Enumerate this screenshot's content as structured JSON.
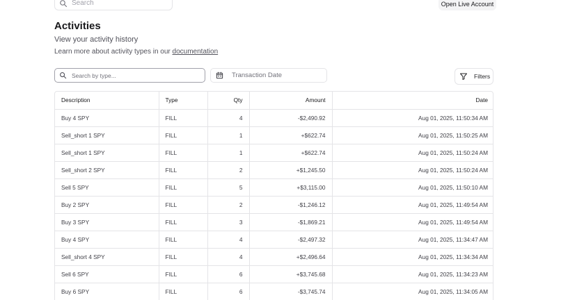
{
  "top_search": {
    "placeholder": "Search"
  },
  "header": {
    "live_account_button": "Open Live Account"
  },
  "page": {
    "title": "Activities",
    "subtitle": "View your activity history",
    "learn_prefix": "Learn more about activity types in our ",
    "learn_link": "documentation"
  },
  "filters": {
    "type_placeholder": "Search by type...",
    "date_placeholder": "Transaction Date",
    "filters_label": "Filters"
  },
  "table": {
    "columns": [
      "Description",
      "Type",
      "Qty",
      "Amount",
      "Date"
    ],
    "rows": [
      [
        "Buy 4 SPY",
        "FILL",
        "4",
        "-$2,490.92",
        "Aug 01, 2025, 11:50:34 AM"
      ],
      [
        "Sell_short 1 SPY",
        "FILL",
        "1",
        "+$622.74",
        "Aug 01, 2025, 11:50:25 AM"
      ],
      [
        "Sell_short 1 SPY",
        "FILL",
        "1",
        "+$622.74",
        "Aug 01, 2025, 11:50:24 AM"
      ],
      [
        "Sell_short 2 SPY",
        "FILL",
        "2",
        "+$1,245.50",
        "Aug 01, 2025, 11:50:24 AM"
      ],
      [
        "Sell 5 SPY",
        "FILL",
        "5",
        "+$3,115.00",
        "Aug 01, 2025, 11:50:10 AM"
      ],
      [
        "Buy 2 SPY",
        "FILL",
        "2",
        "-$1,246.12",
        "Aug 01, 2025, 11:49:54 AM"
      ],
      [
        "Buy 3 SPY",
        "FILL",
        "3",
        "-$1,869.21",
        "Aug 01, 2025, 11:49:54 AM"
      ],
      [
        "Buy 4 SPY",
        "FILL",
        "4",
        "-$2,497.32",
        "Aug 01, 2025, 11:34:47 AM"
      ],
      [
        "Sell_short 4 SPY",
        "FILL",
        "4",
        "+$2,496.64",
        "Aug 01, 2025, 11:34:34 AM"
      ],
      [
        "Sell 6 SPY",
        "FILL",
        "6",
        "+$3,745.68",
        "Aug 01, 2025, 11:34:23 AM"
      ],
      [
        "Buy 6 SPY",
        "FILL",
        "6",
        "-$3,745.74",
        "Aug 01, 2025, 11:34:05 AM"
      ]
    ]
  },
  "icons": {
    "top_search": "search-icon",
    "type_search": "search-icon",
    "date": "calendar-icon",
    "filters": "filter-icon"
  }
}
